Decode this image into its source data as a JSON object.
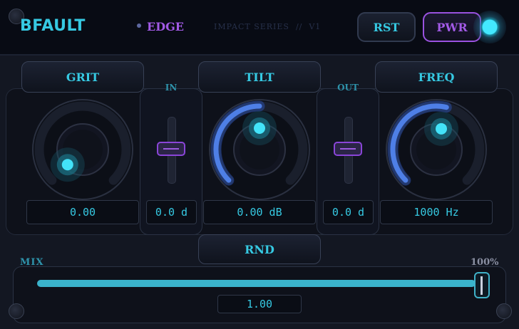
{
  "header": {
    "logo": "BFAULT",
    "mode": "EDGE",
    "series": "IMPACT SERIES  //  V1",
    "reset_label": "RST",
    "power_label": "PWR"
  },
  "controls": {
    "grit": {
      "label": "GRIT",
      "value": "0.00",
      "knob_level": 0.0
    },
    "tilt": {
      "label": "TILT",
      "value": "0.00 dB",
      "knob_level": 0.5
    },
    "freq": {
      "label": "FREQ",
      "value": "1000 Hz",
      "knob_level": 0.55
    },
    "input": {
      "label": "IN",
      "value": "0.0 d",
      "fader_level": 0.5
    },
    "output": {
      "label": "OUT",
      "value": "0.0 d",
      "fader_level": 0.5
    },
    "random_label": "RND"
  },
  "mix": {
    "label": "MIX",
    "percent": "100%",
    "value": "1.00",
    "level": 1.0
  },
  "colors": {
    "accent_cyan": "#36c9e2",
    "accent_purple": "#a25ae6",
    "arc_blue": "#4e7fe6"
  }
}
